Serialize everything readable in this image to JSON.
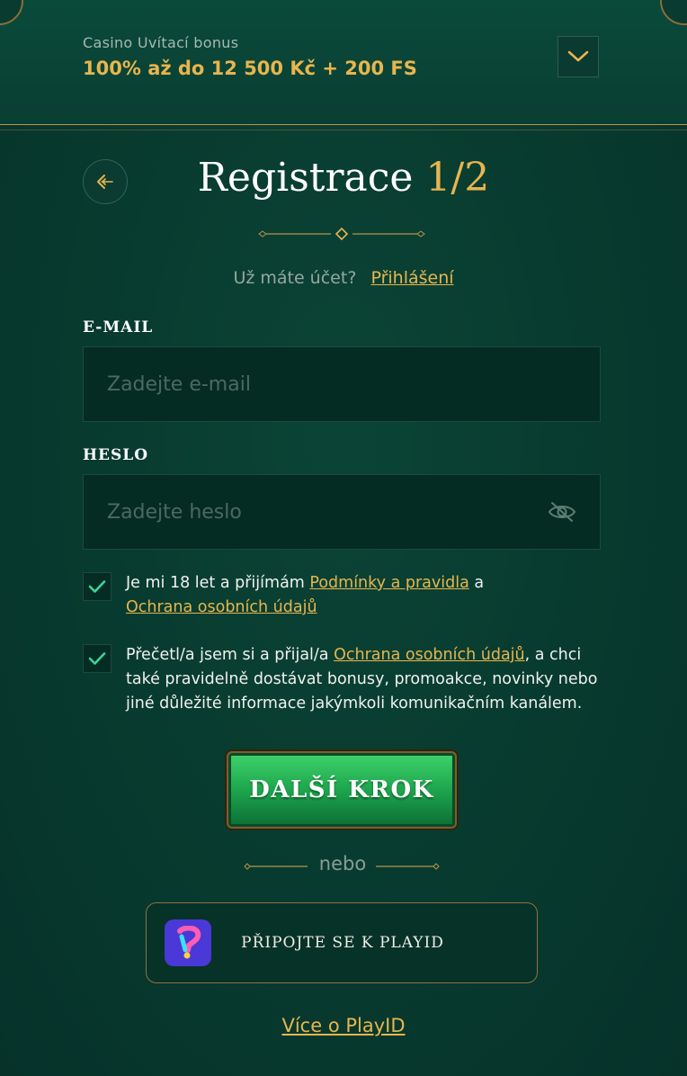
{
  "colors": {
    "accent_gold": "#e7b54e",
    "background_green": "#083b2f",
    "button_green": "#1aa04a",
    "playid_purple": "#4a39d6"
  },
  "bonus": {
    "label": "Casino Uvítací bonus",
    "value": "100% až do 12 500 Kč + 200 FS",
    "toggle_icon": "chevron-down-icon"
  },
  "header": {
    "back_icon": "arrow-back-icon",
    "title": "Registrace",
    "step": "1/2"
  },
  "login": {
    "question": "Už máte účet?",
    "link": "Přihlášení"
  },
  "form": {
    "email": {
      "label": "E-MAIL",
      "placeholder": "Zadejte e-mail",
      "value": ""
    },
    "password": {
      "label": "HESLO",
      "placeholder": "Zadejte heslo",
      "value": "",
      "toggle_icon": "eye-off-icon"
    },
    "consent_terms": {
      "checked": true,
      "text_before": "Je mi 18 let a přijímám ",
      "link1": "Podmínky a pravidla",
      "text_mid": " a ",
      "link2": "Ochrana osobních údajů"
    },
    "consent_marketing": {
      "checked": true,
      "text_before": "Přečetl/a jsem si a přijal/a ",
      "link": "Ochrana osobních údajů",
      "text_after": ", a chci také pravidelně dostávat bonusy, promoakce, novinky nebo jiné důležité informace jakýmkoli komunikačním kanálem."
    },
    "submit_label": "DALŠÍ KROK"
  },
  "alt": {
    "or_text": "nebo",
    "playid_label": "PŘIPOJTE SE K PLAYID",
    "more_link": "Více o PlayID"
  }
}
